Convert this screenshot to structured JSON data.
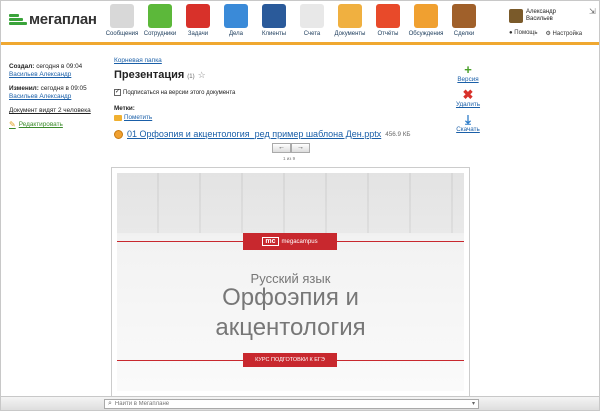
{
  "logo": {
    "text": "мегаплан"
  },
  "nav": [
    {
      "label": "Сообщения",
      "icon": "envelope-icon",
      "color": "#d8d8d8"
    },
    {
      "label": "Сотрудники",
      "icon": "people-icon",
      "color": "#5cb83a"
    },
    {
      "label": "Задачи",
      "icon": "checklist-icon",
      "color": "#d8312a"
    },
    {
      "label": "Дела",
      "icon": "clock-icon",
      "color": "#3a8ad8"
    },
    {
      "label": "Клиенты",
      "icon": "contacts-book-icon",
      "color": "#2a5a9a"
    },
    {
      "label": "Счета",
      "icon": "invoice-icon",
      "color": "#e8e8e8"
    },
    {
      "label": "Документы",
      "icon": "folder-icon",
      "color": "#f0b040",
      "active": true
    },
    {
      "label": "Отчёты",
      "icon": "bar-chart-icon",
      "color": "#e84a2a"
    },
    {
      "label": "Обсуждения",
      "icon": "speech-bubbles-icon",
      "color": "#f0a030"
    },
    {
      "label": "Сделки",
      "icon": "briefcase-icon",
      "color": "#a0602a"
    }
  ],
  "user": {
    "first": "Александр",
    "last": "Васильев"
  },
  "help": {
    "help_label": "Помощь",
    "settings_label": "Настройка"
  },
  "sidebar": {
    "created_label": "Создал:",
    "created_time": "сегодня в 09:04",
    "created_by": "Васильев Александр",
    "changed_label": "Изменил:",
    "changed_time": "сегодня в 09:05",
    "changed_by": "Васильев Александр",
    "visibility": "Документ видят 2 человека",
    "edit_label": "Редактировать"
  },
  "breadcrumb": "Корневая папка",
  "document": {
    "title": "Презентация",
    "version_count": "(1)",
    "subscribe_label": "Подписаться на версии этого документа",
    "subscribe_checked": "✓",
    "tags_label": "Метки:",
    "tag_link": "Пометить"
  },
  "actions": {
    "version": "Версия",
    "delete": "Удалить",
    "download": "Скачать"
  },
  "file": {
    "name": "01 Орфоэпия и акцентология_ред пример шаблона Ден.pptx",
    "size": "456.9 КБ"
  },
  "pager": {
    "prev": "←",
    "next": "→",
    "info": "1 из 9"
  },
  "slide": {
    "brand_mark": "mc",
    "brand_text": "megacampus",
    "subtitle": "Русский язык",
    "title_line1": "Орфоэпия и",
    "title_line2": "акцентология",
    "button": "КУРС ПОДГОТОВКИ К ЕГЭ"
  },
  "search": {
    "placeholder": "Найти в Мегаплане"
  }
}
